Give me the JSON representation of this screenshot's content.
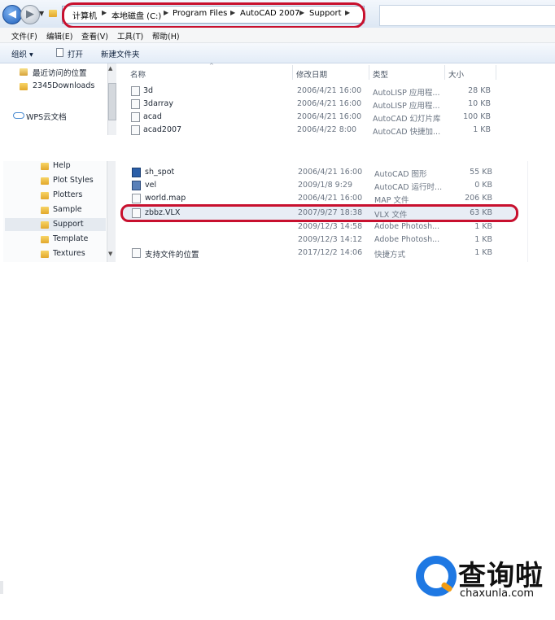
{
  "breadcrumb": [
    "计算机",
    "本地磁盘 (C:)",
    "Program Files",
    "AutoCAD 2007",
    "Support"
  ],
  "menu": [
    "文件(F)",
    "编辑(E)",
    "查看(V)",
    "工具(T)",
    "帮助(H)"
  ],
  "toolbar": {
    "organize": "组织 ▾",
    "open": "打开",
    "new_folder": "新建文件夹"
  },
  "left_upper": [
    "最近访问的位置",
    "2345Downloads",
    "WPS云文档"
  ],
  "left_lower": [
    "Help",
    "Plot Styles",
    "Plotters",
    "Sample",
    "Support",
    "Template",
    "Textures"
  ],
  "columns": {
    "name": "名称",
    "modified": "修改日期",
    "type": "类型",
    "size": "大小"
  },
  "files_upper": [
    {
      "name": "3d",
      "date": "2006/4/21 16:00",
      "type": "AutoLISP 应用程...",
      "size": "28 KB"
    },
    {
      "name": "3darray",
      "date": "2006/4/21 16:00",
      "type": "AutoLISP 应用程...",
      "size": "10 KB"
    },
    {
      "name": "acad",
      "date": "2006/4/21 16:00",
      "type": "AutoCAD 幻灯片库",
      "size": "100 KB"
    },
    {
      "name": "acad2007",
      "date": "2006/4/22 8:00",
      "type": "AutoCAD 快捷加...",
      "size": "1 KB"
    }
  ],
  "files_lower": [
    {
      "name": "sh_spot",
      "date": "2006/4/21 16:00",
      "type": "AutoCAD 图形",
      "size": "55 KB"
    },
    {
      "name": "vel",
      "date": "2009/1/8 9:29",
      "type": "AutoCAD 运行时...",
      "size": "0 KB"
    },
    {
      "name": "world.map",
      "date": "2006/4/21 16:00",
      "type": "MAP 文件",
      "size": "206 KB"
    },
    {
      "name": "zbbz.VLX",
      "date": "2007/9/27 18:38",
      "type": "VLX 文件",
      "size": "63 KB"
    },
    {
      "name": "",
      "date": "2009/12/3 14:58",
      "type": "Adobe Photosh...",
      "size": "1 KB"
    },
    {
      "name": "",
      "date": "2009/12/3 14:12",
      "type": "Adobe Photosh...",
      "size": "1 KB"
    },
    {
      "name": "支持文件的位置",
      "date": "2017/12/2 14:06",
      "type": "快捷方式",
      "size": "1 KB"
    }
  ],
  "watermark": {
    "text": "查询啦",
    "url": "chaxunla.com"
  }
}
